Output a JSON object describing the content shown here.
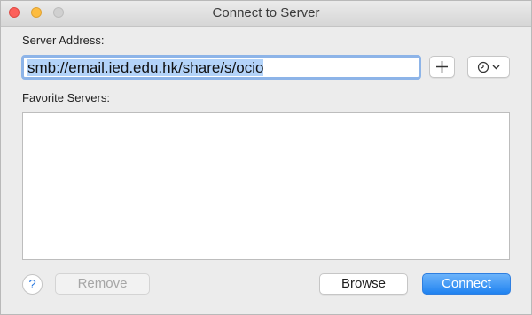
{
  "window": {
    "title": "Connect to Server"
  },
  "address": {
    "label": "Server Address:",
    "value": "smb://email.ied.edu.hk/share/s/ocio"
  },
  "buttons": {
    "add_icon": "plus-icon",
    "recent_icon": "clock-icon",
    "help_label": "?",
    "remove_label": "Remove",
    "browse_label": "Browse",
    "connect_label": "Connect"
  },
  "favorites": {
    "label": "Favorite Servers:",
    "items": []
  },
  "colors": {
    "accent": "#1f82f0",
    "selection": "#b3d3f9",
    "focus_ring": "#8db4e8"
  }
}
